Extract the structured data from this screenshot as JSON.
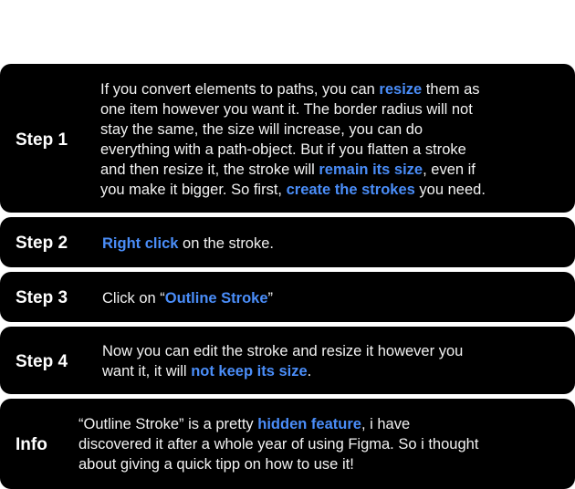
{
  "accent_color": "#4a8df8",
  "steps": [
    {
      "label": "Step 1",
      "lines": [
        [
          {
            "t": "If you convert elements to paths, you can "
          },
          {
            "t": "resize",
            "h": true
          },
          {
            "t": " them as"
          }
        ],
        [
          {
            "t": "one item however you want it. The border radius will not"
          }
        ],
        [
          {
            "t": "stay the same, the size will increase, you can do"
          }
        ],
        [
          {
            "t": "everything with a path-object. But if you flatten a stroke"
          }
        ],
        [
          {
            "t": "and then resize it, the stroke will "
          },
          {
            "t": "remain its size",
            "h": true
          },
          {
            "t": ", even if"
          }
        ],
        [
          {
            "t": "you make it bigger. So first, "
          },
          {
            "t": "create the strokes",
            "h": true
          },
          {
            "t": " you need."
          }
        ]
      ]
    },
    {
      "label": "Step 2",
      "lines": [
        [
          {
            "t": "Right click",
            "h": true
          },
          {
            "t": " on the stroke."
          }
        ]
      ]
    },
    {
      "label": "Step 3",
      "lines": [
        [
          {
            "t": "Click on “"
          },
          {
            "t": "Outline Stroke",
            "h": true
          },
          {
            "t": "”"
          }
        ]
      ]
    },
    {
      "label": "Step 4",
      "lines": [
        [
          {
            "t": "Now you can edit the stroke and resize it however you"
          }
        ],
        [
          {
            "t": "want it, it will "
          },
          {
            "t": "not keep its size",
            "h": true
          },
          {
            "t": "."
          }
        ]
      ]
    },
    {
      "label": "Info",
      "lines": [
        [
          {
            "t": "“Outline Stroke” is a pretty "
          },
          {
            "t": "hidden feature",
            "h": true
          },
          {
            "t": ", i have"
          }
        ],
        [
          {
            "t": "discovered it after a whole year of using Figma. So i thought"
          }
        ],
        [
          {
            "t": "about giving a quick tipp on how to use it!"
          }
        ]
      ]
    }
  ]
}
